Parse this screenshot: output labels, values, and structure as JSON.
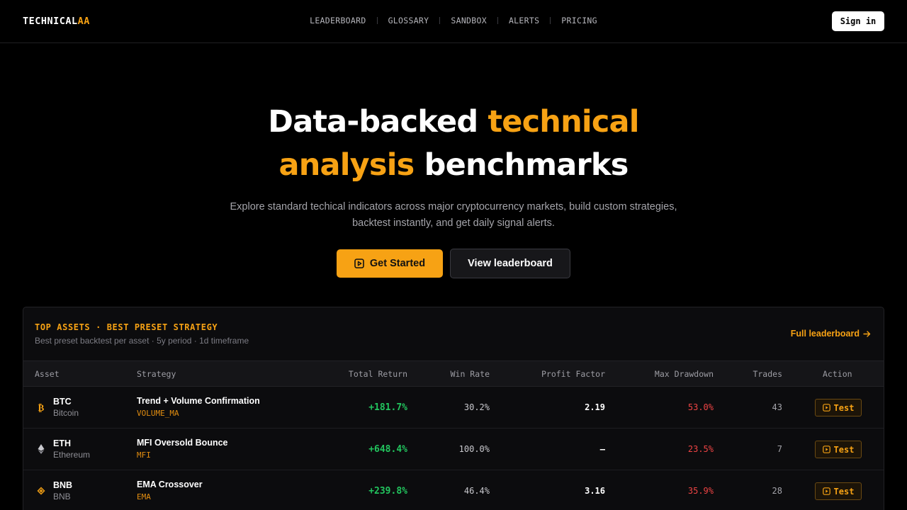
{
  "header": {
    "logo_main": "TECHNICAL",
    "logo_accent": "AA",
    "nav": [
      "LEADERBOARD",
      "GLOSSARY",
      "SANDBOX",
      "ALERTS",
      "PRICING"
    ],
    "signin_label": "Sign in"
  },
  "hero": {
    "title_part1": "Data-backed ",
    "title_accent1": "technical",
    "title_accent2": "analysis",
    "title_part2": " benchmarks",
    "subtitle_line1": "Explore standard techical indicators across major cryptocurrency markets, build custom strategies,",
    "subtitle_line2": "backtest instantly, and get daily signal alerts.",
    "primary_label": "Get Started",
    "secondary_label": "View leaderboard"
  },
  "panel": {
    "title": "TOP ASSETS · BEST PRESET STRATEGY",
    "subtitle": "Best preset backtest per asset · 5y period · 1d timeframe",
    "link_label": "Full leaderboard",
    "columns": [
      "Asset",
      "Strategy",
      "Total Return",
      "Win Rate",
      "Profit Factor",
      "Max Drawdown",
      "Trades",
      "Action"
    ],
    "rows": [
      {
        "symbol": "BTC",
        "name": "Bitcoin",
        "strategy": "Trend + Volume Confirmation",
        "tag": "VOLUME_MA",
        "total_return": "+181.7%",
        "win_rate": "30.2%",
        "profit_factor": "2.19",
        "max_drawdown": "53.0%",
        "trades": "43",
        "action": "Test",
        "icon": "bitcoin-icon"
      },
      {
        "symbol": "ETH",
        "name": "Ethereum",
        "strategy": "MFI Oversold Bounce",
        "tag": "MFI",
        "total_return": "+648.4%",
        "win_rate": "100.0%",
        "profit_factor": "–",
        "max_drawdown": "23.5%",
        "trades": "7",
        "action": "Test",
        "icon": "ethereum-icon"
      },
      {
        "symbol": "BNB",
        "name": "BNB",
        "strategy": "EMA Crossover",
        "tag": "EMA",
        "total_return": "+239.8%",
        "win_rate": "46.4%",
        "profit_factor": "3.16",
        "max_drawdown": "35.9%",
        "trades": "28",
        "action": "Test",
        "icon": "bnb-icon"
      }
    ]
  },
  "colors": {
    "accent": "#f7a214",
    "positive": "#22c55e",
    "negative": "#ef4444",
    "background": "#000000"
  }
}
